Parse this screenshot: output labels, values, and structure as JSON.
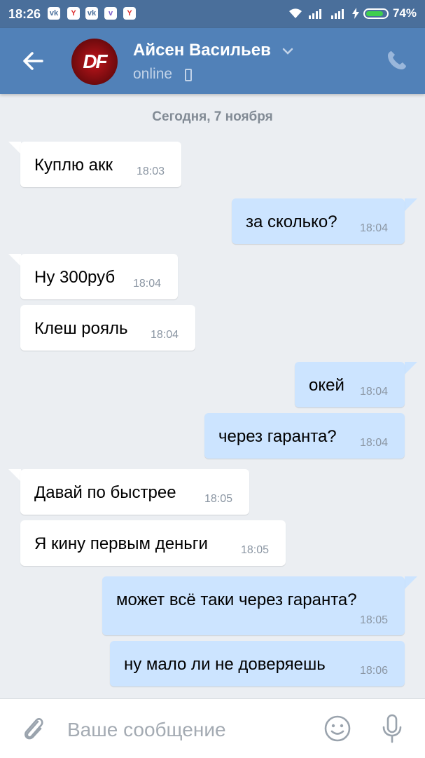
{
  "statusbar": {
    "time": "18:26",
    "battery": "74%",
    "notifications": [
      "vk",
      "yandex",
      "vk",
      "viber",
      "yandex"
    ]
  },
  "header": {
    "name": "Айсен Васильев",
    "status": "online",
    "avatar_text": "DF"
  },
  "chat": {
    "date": "Сегодня, 7 ноября",
    "messages": [
      {
        "dir": "in",
        "text": "Куплю акк",
        "time": "18:03"
      },
      {
        "dir": "out",
        "text": "за сколько?",
        "time": "18:04"
      },
      {
        "dir": "in",
        "text": "Ну 300руб",
        "time": "18:04"
      },
      {
        "dir": "in",
        "text": "Клеш рояль",
        "time": "18:04"
      },
      {
        "dir": "out",
        "text": "окей",
        "time": "18:04"
      },
      {
        "dir": "out",
        "text": "через гаранта?",
        "time": "18:04"
      },
      {
        "dir": "in",
        "text": "Давай по быстрее",
        "time": "18:05"
      },
      {
        "dir": "in",
        "text": "Я кину первым деньги",
        "time": "18:05"
      },
      {
        "dir": "out",
        "text": "может всё таки через гаранта?",
        "time": "18:05"
      },
      {
        "dir": "out",
        "text": "ну мало ли не доверяешь",
        "time": "18:06"
      }
    ]
  },
  "composer": {
    "placeholder": "Ваше сообщение"
  },
  "colors": {
    "header": "#5181b8",
    "statusbar": "#4a6f9b",
    "background": "#ebeef2",
    "incoming": "#ffffff",
    "outgoing": "#cce4ff"
  }
}
